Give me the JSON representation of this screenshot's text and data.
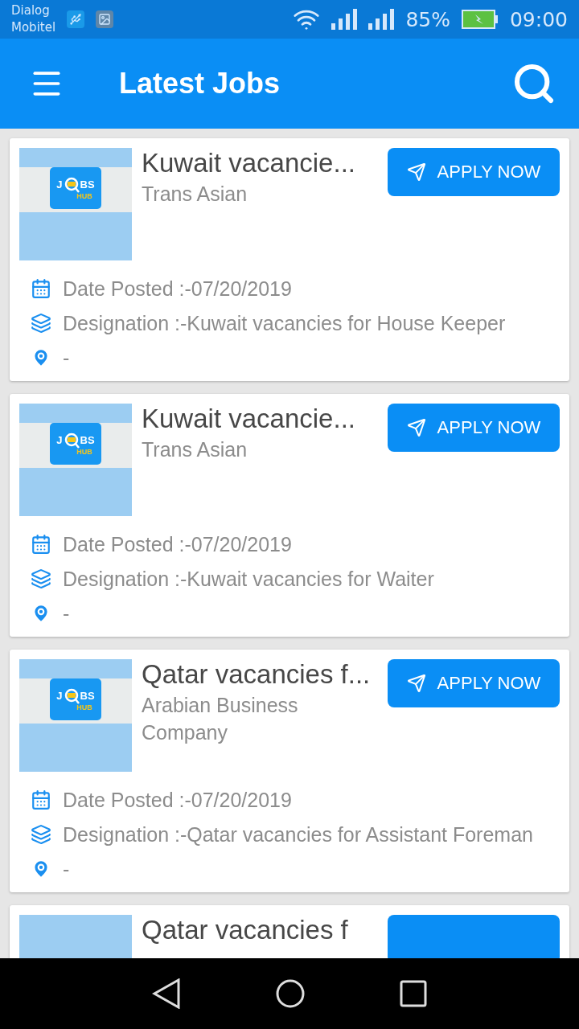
{
  "status_bar": {
    "carrier_lines": [
      "Dialog",
      "Mobitel"
    ],
    "battery": "85%",
    "time": "09:00"
  },
  "app_bar": {
    "title": "Latest Jobs"
  },
  "jobs": [
    {
      "logo": {
        "left": "J",
        "right": "BS",
        "sub": "HUB"
      },
      "title": "Kuwait vacancie...",
      "company": "Trans Asian",
      "apply_label": "APPLY NOW",
      "details": [
        {
          "kind": "date",
          "text": "Date Posted :-07/20/2019"
        },
        {
          "kind": "designation",
          "text": "Designation :-Kuwait vacancies for House Keeper"
        },
        {
          "kind": "location",
          "text": "-"
        }
      ]
    },
    {
      "logo": {
        "left": "J",
        "right": "BS",
        "sub": "HUB"
      },
      "title": "Kuwait vacancie...",
      "company": "Trans Asian",
      "apply_label": "APPLY NOW",
      "details": [
        {
          "kind": "date",
          "text": "Date Posted :-07/20/2019"
        },
        {
          "kind": "designation",
          "text": "Designation :-Kuwait vacancies for Waiter"
        },
        {
          "kind": "location",
          "text": "-"
        }
      ]
    },
    {
      "logo": {
        "left": "J",
        "right": "BS",
        "sub": "HUB"
      },
      "title": "Qatar vacancies f...",
      "company": "Arabian Business Company",
      "apply_label": "APPLY NOW",
      "details": [
        {
          "kind": "date",
          "text": "Date Posted :-07/20/2019"
        },
        {
          "kind": "designation",
          "text": "Designation :-Qatar vacancies for Assistant Foreman"
        },
        {
          "kind": "location",
          "text": "-"
        }
      ]
    },
    {
      "title": "Qatar vacancies f"
    }
  ]
}
